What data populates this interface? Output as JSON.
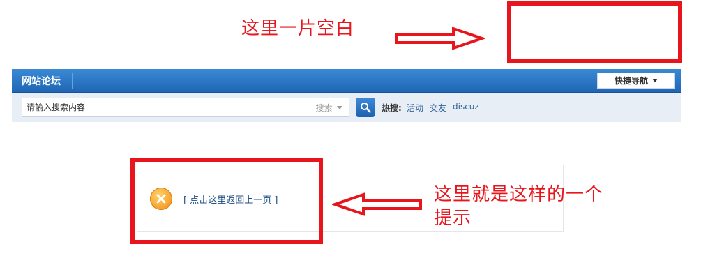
{
  "annotations": {
    "top_note": "这里一片空白",
    "bottom_note": "这里就是这样的一个提示",
    "accent_color": "#e8161c"
  },
  "navbar": {
    "site_title": "网站论坛",
    "quick_nav_label": "快捷导航"
  },
  "search": {
    "placeholder": "请输入搜索内容",
    "type_label": "搜索",
    "button_icon": "search-icon",
    "hot_label": "热搜:",
    "hot_terms": [
      "活动",
      "交友",
      "discuz"
    ]
  },
  "message": {
    "icon": "error-icon",
    "back_link": "[ 点击这里返回上一页 ]"
  }
}
